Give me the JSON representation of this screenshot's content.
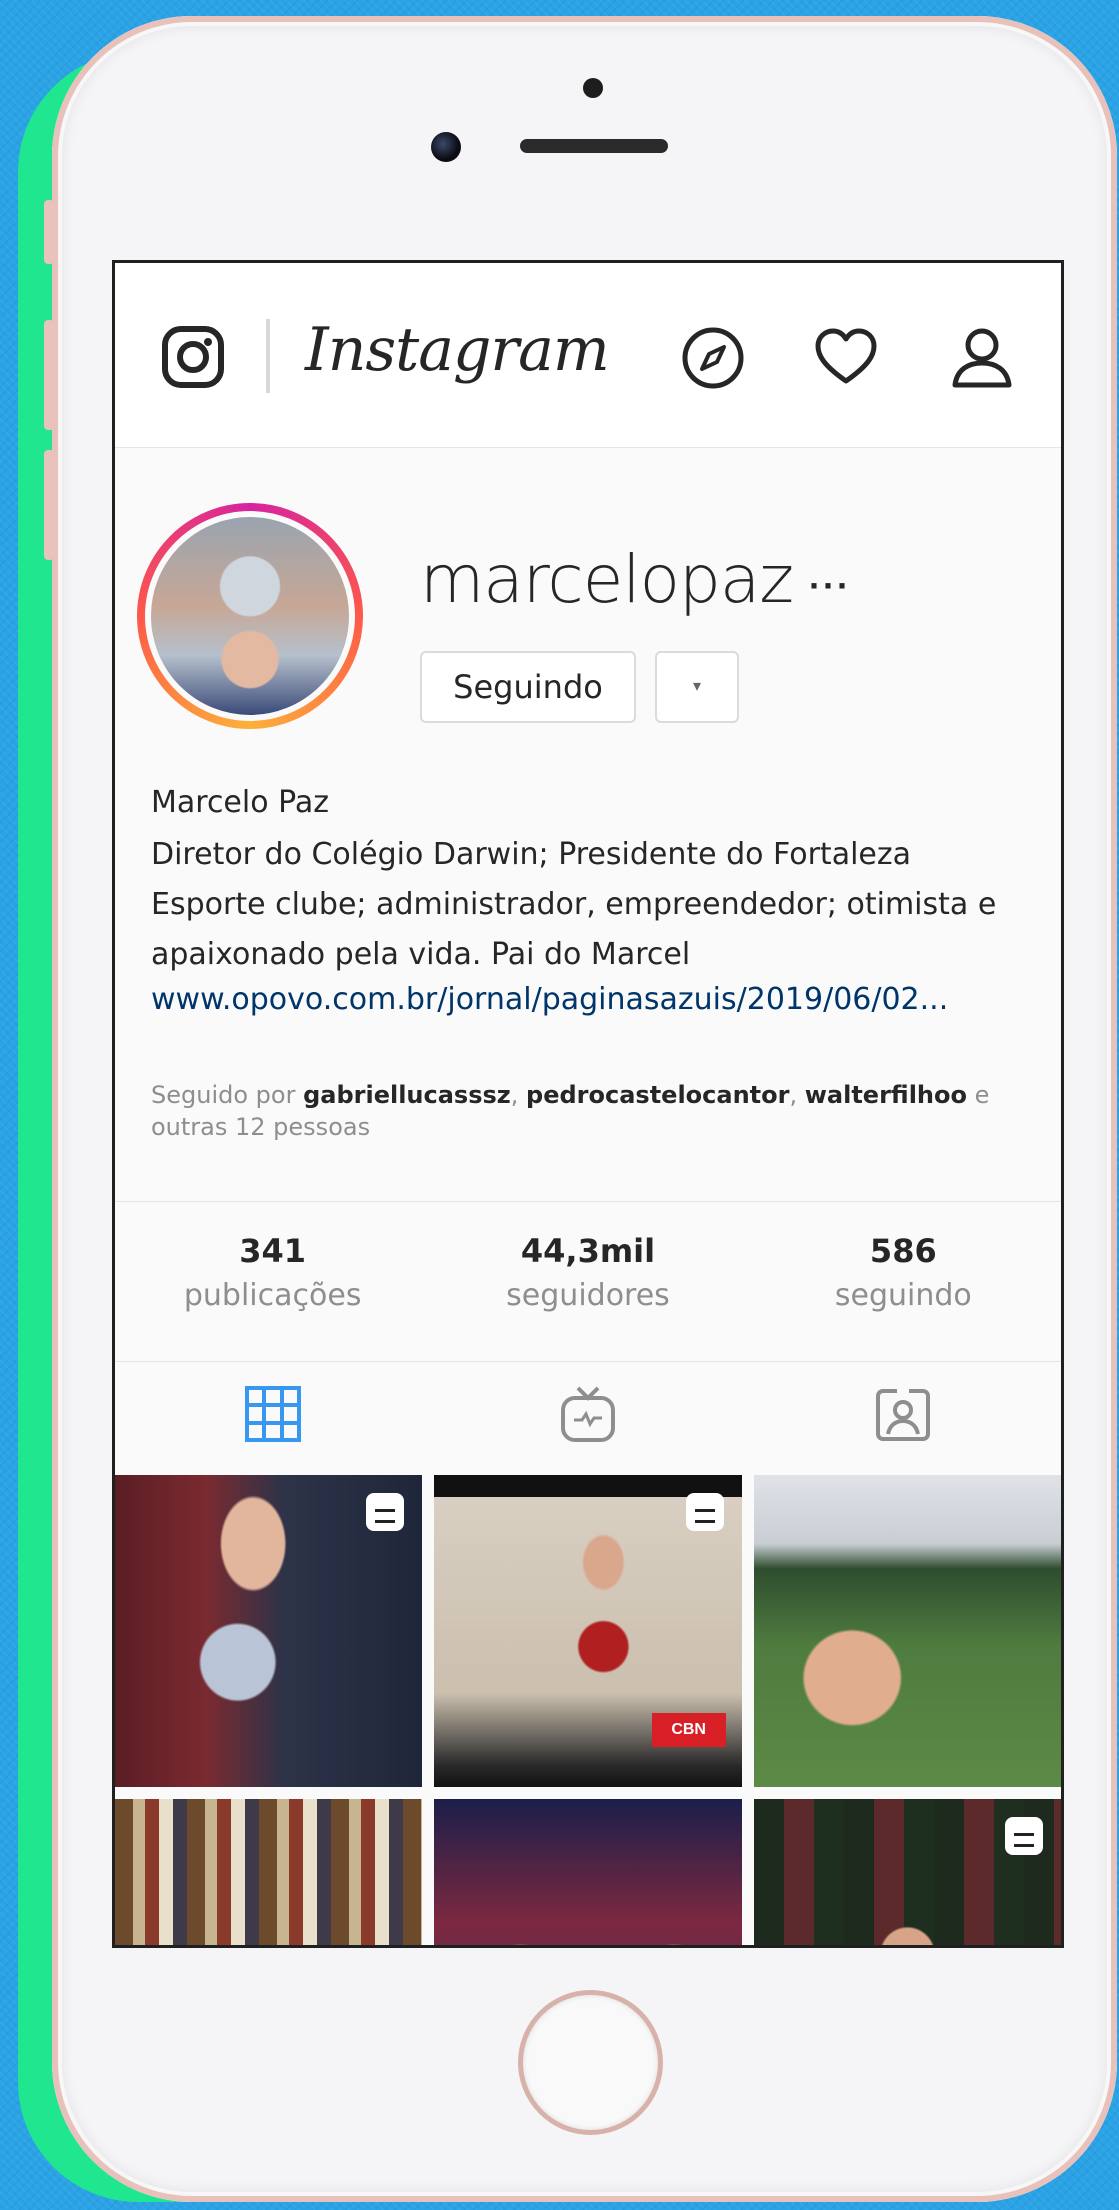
{
  "header": {
    "wordmark": "Instagram",
    "icons": [
      "instagram-logo-icon",
      "compass-icon",
      "heart-icon",
      "user-icon"
    ]
  },
  "profile": {
    "username": "marcelopaz",
    "follow_button": "Seguindo",
    "dropdown_label": "▾",
    "more_label": "···",
    "full_name": "Marcelo Paz",
    "bio": "Diretor do Colégio Darwin; Presidente do Fortaleza Esporte clube; administrador, empreendedor; otimista e apaixonado pela vida. Pai do Marcel",
    "link": "www.opovo.com.br/jornal/paginasazuis/2019/06/02...",
    "followed_by_prefix": "Seguido por ",
    "followed_by_users": [
      "gabriellucasssz",
      "pedrocastelocantor",
      "walterfilhoo"
    ],
    "followed_by_suffix": " e outras 12 pessoas"
  },
  "stats": [
    {
      "num": "341",
      "label": "publicações"
    },
    {
      "num": "44,3mil",
      "label": "seguidores"
    },
    {
      "num": "586",
      "label": "seguindo"
    }
  ],
  "tabs": [
    "grid-icon",
    "igtv-icon",
    "tagged-icon"
  ],
  "colors": {
    "background": "#2aa3e6",
    "shadow_phone": "#1fe68f",
    "rose_gold": "#e8c2ba",
    "link": "#003569",
    "active_tab": "#3897f0"
  },
  "posts": [
    {
      "badge": true
    },
    {
      "badge": true,
      "overlay": "CBN"
    },
    {
      "badge": false
    },
    {
      "badge": false
    },
    {
      "badge": false
    },
    {
      "badge": true
    }
  ]
}
